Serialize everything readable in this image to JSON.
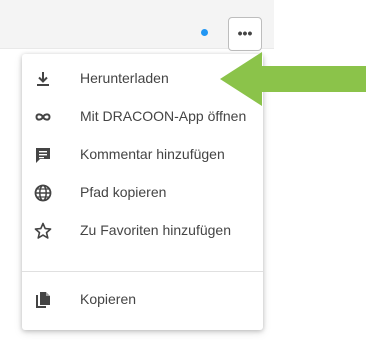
{
  "toolbar": {
    "more_label": "•••",
    "status_dot_color": "#2196f3"
  },
  "menu": {
    "items": [
      {
        "label": "Herunterladen",
        "icon": "download-icon"
      },
      {
        "label": "Mit DRACOON-App öffnen",
        "icon": "infinity-icon"
      },
      {
        "label": "Kommentar hinzufügen",
        "icon": "comment-icon"
      },
      {
        "label": "Pfad kopieren",
        "icon": "globe-icon"
      },
      {
        "label": "Zu Favoriten hinzufügen",
        "icon": "star-icon"
      },
      {
        "label": "Kopieren",
        "icon": "copy-icon"
      }
    ]
  },
  "colors": {
    "icon": "#444444",
    "text": "#444444",
    "arrow": "#8bc34a"
  }
}
